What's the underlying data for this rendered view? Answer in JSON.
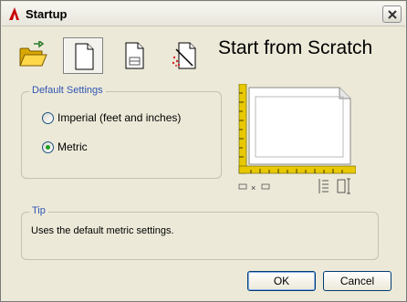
{
  "window": {
    "title": "Startup"
  },
  "toolbar": {
    "buttons": [
      {
        "icon": "open-folder-icon",
        "active": false
      },
      {
        "icon": "blank-page-icon",
        "active": true
      },
      {
        "icon": "template-page-icon",
        "active": false
      },
      {
        "icon": "wizard-icon",
        "active": false
      }
    ]
  },
  "heading": "Start from Scratch",
  "default_settings": {
    "legend": "Default Settings",
    "options": [
      {
        "label": "Imperial (feet and inches)",
        "checked": false
      },
      {
        "label": "Metric",
        "checked": true
      }
    ]
  },
  "tip": {
    "legend": "Tip",
    "text": "Uses the default metric settings."
  },
  "buttons": {
    "ok": "OK",
    "cancel": "Cancel"
  },
  "colors": {
    "accent": "#2f55b4",
    "ruler": "#e8c800",
    "radio_dot": "#21a121"
  }
}
